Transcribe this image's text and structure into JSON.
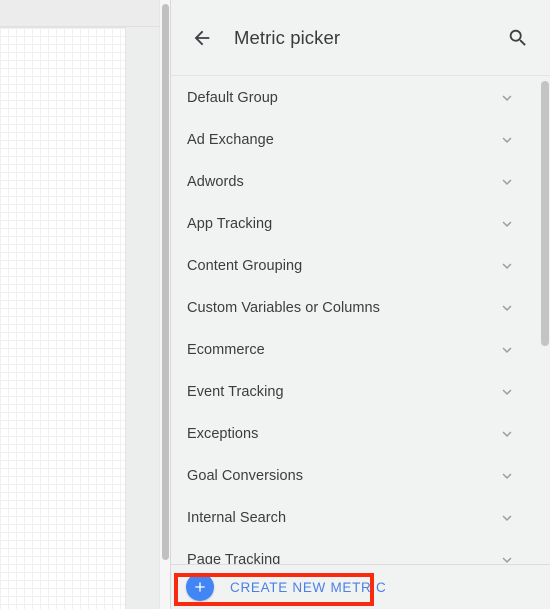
{
  "window": {
    "background_color": "#eceded"
  },
  "left_canvas": {
    "name": "grid-canvas",
    "description": "grid-paper-background",
    "background_color": "#ffffff",
    "grid_line_color": "#f0f0f0"
  },
  "outer_scrollbar": {
    "name": "page-scrollbar",
    "thumb_color": "#c1c1c1"
  },
  "panel": {
    "header": {
      "back_icon": "arrow-left-icon",
      "title": "Metric picker",
      "search_icon": "search-icon"
    },
    "list": {
      "expand_icon": "chevron-down-icon",
      "items": [
        {
          "label": "Default Group"
        },
        {
          "label": "Ad Exchange"
        },
        {
          "label": "Adwords"
        },
        {
          "label": "App Tracking"
        },
        {
          "label": "Content Grouping"
        },
        {
          "label": "Custom Variables or Columns"
        },
        {
          "label": "Ecommerce"
        },
        {
          "label": "Event Tracking"
        },
        {
          "label": "Exceptions"
        },
        {
          "label": "Goal Conversions"
        },
        {
          "label": "Internal Search"
        },
        {
          "label": "Page Tracking"
        }
      ],
      "scrollbar": {
        "thumb_color": "#c3c4c4"
      }
    },
    "footer": {
      "add_icon": "plus-icon",
      "create_label": "CREATE NEW METRIC",
      "accent_color": "#4285f4",
      "label_color": "#4a7fe8"
    }
  },
  "annotation": {
    "highlight_color": "#fa2a11",
    "target": "create-new-metric-button"
  }
}
